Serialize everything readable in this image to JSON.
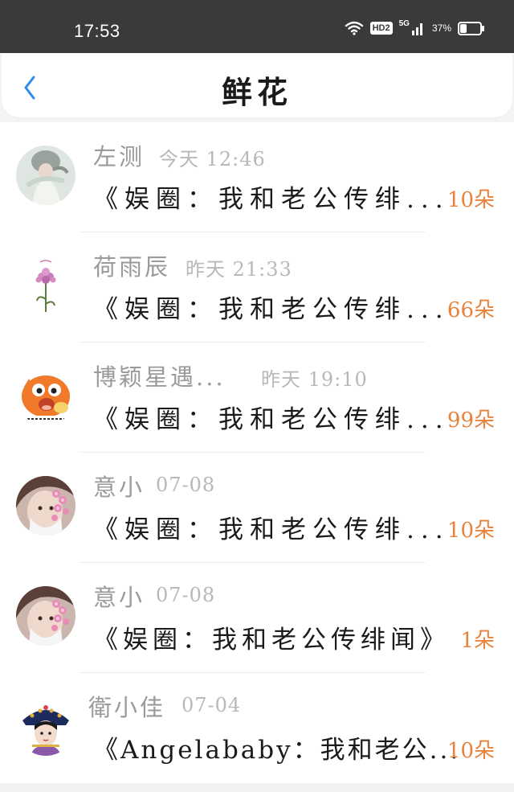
{
  "status_bar": {
    "time": "17:53",
    "hd_label": "HD2",
    "network_label": "5G",
    "battery_percent_text": "37%",
    "battery_level": 0.37,
    "icons": [
      "wifi-icon",
      "hd-badge-icon",
      "signal-5g-icon",
      "battery-icon"
    ]
  },
  "header": {
    "title": "鲜花",
    "back_icon": "chevron-left-icon",
    "accent_color": "#2d8cf0"
  },
  "colors": {
    "count_color": "#e8823a",
    "name_color": "#9a9a9a",
    "time_color": "#b8b8b8"
  },
  "list": [
    {
      "name": "左测",
      "time": "今天 12:46",
      "message": "《娱圈：我和老公传绯...",
      "count": "10朵",
      "avatar": "avatar-dancer"
    },
    {
      "name": "荷雨辰",
      "time": "昨天 21:33",
      "message": "《娱圈：我和老公传绯...",
      "count": "66朵",
      "avatar": "avatar-flower"
    },
    {
      "name": "博颖星遇...",
      "time": "昨天 19:10",
      "message": "《娱圈：我和老公传绯...",
      "count": "99朵",
      "avatar": "avatar-cartoon-dragon"
    },
    {
      "name": "意小",
      "time": "07-08",
      "message": "《娱圈：我和老公传绯...",
      "count": "10朵",
      "avatar": "avatar-girl-flowers"
    },
    {
      "name": "意小",
      "time": "07-08",
      "message": "《娱圈：我和老公传绯闻》",
      "count": "1朵",
      "avatar": "avatar-girl-flowers"
    },
    {
      "name": "衛小佳",
      "time": "07-04",
      "message": "《Angelababy：我和老公...",
      "count": "10朵",
      "avatar": "avatar-qing-lady"
    }
  ]
}
